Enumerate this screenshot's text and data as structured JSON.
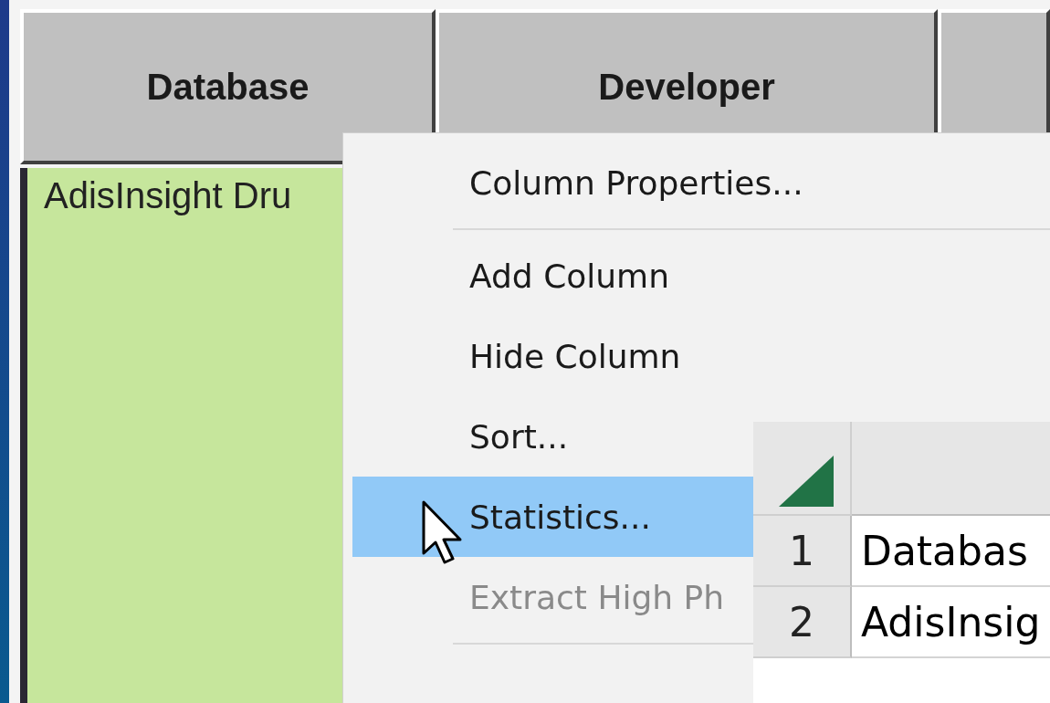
{
  "table": {
    "columns": [
      "Database",
      "Developer"
    ],
    "rows": [
      [
        "AdisInsight Dru"
      ]
    ]
  },
  "context_menu": {
    "items": [
      {
        "kind": "item",
        "label": "Column Properties...",
        "disabled": false,
        "selected": false
      },
      {
        "kind": "separator"
      },
      {
        "kind": "item",
        "label": "Add Column",
        "disabled": false,
        "selected": false
      },
      {
        "kind": "item",
        "label": "Hide Column",
        "disabled": false,
        "selected": false
      },
      {
        "kind": "item",
        "label": "Sort...",
        "disabled": false,
        "selected": false
      },
      {
        "kind": "item",
        "label": "Statistics...",
        "disabled": false,
        "selected": true
      },
      {
        "kind": "item",
        "label": "Extract High Ph",
        "disabled": true,
        "selected": false
      },
      {
        "kind": "separator"
      }
    ]
  },
  "spreadsheet": {
    "rows": [
      {
        "number": "1",
        "cell": "Databas"
      },
      {
        "number": "2",
        "cell": "AdisInsig"
      }
    ]
  }
}
